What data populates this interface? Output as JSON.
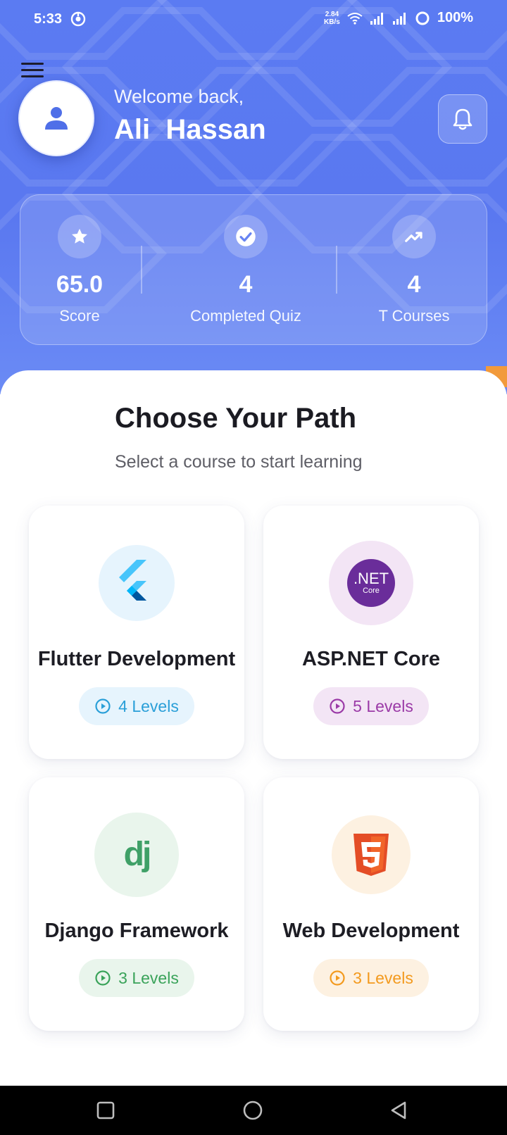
{
  "status_bar": {
    "time": "5:33",
    "net_speed_value": "2.84",
    "net_speed_unit": "KB/s",
    "battery": "100%",
    "icons": [
      "app-notification-icon",
      "wifi-icon",
      "signal-icon",
      "signal-icon",
      "battery-ring-icon"
    ]
  },
  "header": {
    "welcome": "Welcome back,",
    "user_name": "Ali  Hassan",
    "icons": [
      "menu-icon",
      "person-icon",
      "bell-icon"
    ]
  },
  "stats": [
    {
      "icon": "star-icon",
      "value": "65.0",
      "label": "Score"
    },
    {
      "icon": "check-circle-icon",
      "value": "4",
      "label": "Completed Quiz"
    },
    {
      "icon": "trending-up-icon",
      "value": "4",
      "label": "T Courses"
    }
  ],
  "section": {
    "title": "Choose Your Path",
    "subtitle": "Select a course to start learning"
  },
  "courses": [
    {
      "name": "Flutter Development",
      "levels": "4 Levels",
      "icon": "flutter-logo-icon",
      "color": "#2a9fd8",
      "tint": "#e6f4fd"
    },
    {
      "name": "ASP.NET Core",
      "levels": "5 Levels",
      "icon": "dotnet-logo-icon",
      "logo_text": ".NET",
      "logo_subtext": "Core",
      "color": "#9b3aa7",
      "tint": "#f3e5f5"
    },
    {
      "name": "Django Framework",
      "levels": "3 Levels",
      "icon": "django-logo-icon",
      "logo_text": "dj",
      "color": "#3aa35a",
      "tint": "#e9f5ec"
    },
    {
      "name": "Web Development",
      "levels": "3 Levels",
      "icon": "html5-logo-icon",
      "color": "#f39a1e",
      "tint": "#fdf1e1"
    }
  ],
  "colors": {
    "header_blue": "#5b7bf2",
    "accent_blue": "#4f6fe8",
    "orange": "#f29a3b"
  },
  "nav_bar": {
    "icons": [
      "recents-square-icon",
      "home-circle-icon",
      "back-triangle-icon"
    ]
  }
}
